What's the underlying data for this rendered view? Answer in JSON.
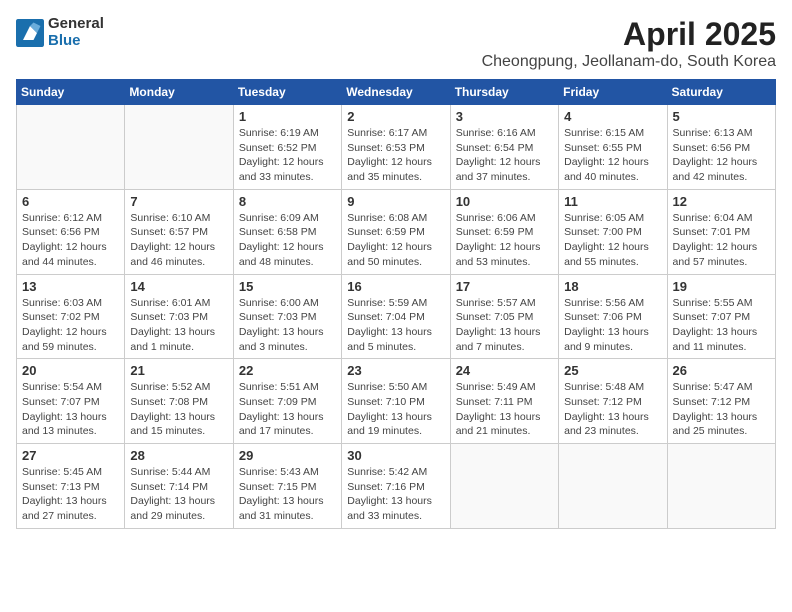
{
  "header": {
    "logo_general": "General",
    "logo_blue": "Blue",
    "month_title": "April 2025",
    "location": "Cheongpung, Jeollanam-do, South Korea"
  },
  "days_of_week": [
    "Sunday",
    "Monday",
    "Tuesday",
    "Wednesday",
    "Thursday",
    "Friday",
    "Saturday"
  ],
  "weeks": [
    [
      {
        "day": null
      },
      {
        "day": null
      },
      {
        "day": "1",
        "sunrise": "Sunrise: 6:19 AM",
        "sunset": "Sunset: 6:52 PM",
        "daylight": "Daylight: 12 hours and 33 minutes."
      },
      {
        "day": "2",
        "sunrise": "Sunrise: 6:17 AM",
        "sunset": "Sunset: 6:53 PM",
        "daylight": "Daylight: 12 hours and 35 minutes."
      },
      {
        "day": "3",
        "sunrise": "Sunrise: 6:16 AM",
        "sunset": "Sunset: 6:54 PM",
        "daylight": "Daylight: 12 hours and 37 minutes."
      },
      {
        "day": "4",
        "sunrise": "Sunrise: 6:15 AM",
        "sunset": "Sunset: 6:55 PM",
        "daylight": "Daylight: 12 hours and 40 minutes."
      },
      {
        "day": "5",
        "sunrise": "Sunrise: 6:13 AM",
        "sunset": "Sunset: 6:56 PM",
        "daylight": "Daylight: 12 hours and 42 minutes."
      }
    ],
    [
      {
        "day": "6",
        "sunrise": "Sunrise: 6:12 AM",
        "sunset": "Sunset: 6:56 PM",
        "daylight": "Daylight: 12 hours and 44 minutes."
      },
      {
        "day": "7",
        "sunrise": "Sunrise: 6:10 AM",
        "sunset": "Sunset: 6:57 PM",
        "daylight": "Daylight: 12 hours and 46 minutes."
      },
      {
        "day": "8",
        "sunrise": "Sunrise: 6:09 AM",
        "sunset": "Sunset: 6:58 PM",
        "daylight": "Daylight: 12 hours and 48 minutes."
      },
      {
        "day": "9",
        "sunrise": "Sunrise: 6:08 AM",
        "sunset": "Sunset: 6:59 PM",
        "daylight": "Daylight: 12 hours and 50 minutes."
      },
      {
        "day": "10",
        "sunrise": "Sunrise: 6:06 AM",
        "sunset": "Sunset: 6:59 PM",
        "daylight": "Daylight: 12 hours and 53 minutes."
      },
      {
        "day": "11",
        "sunrise": "Sunrise: 6:05 AM",
        "sunset": "Sunset: 7:00 PM",
        "daylight": "Daylight: 12 hours and 55 minutes."
      },
      {
        "day": "12",
        "sunrise": "Sunrise: 6:04 AM",
        "sunset": "Sunset: 7:01 PM",
        "daylight": "Daylight: 12 hours and 57 minutes."
      }
    ],
    [
      {
        "day": "13",
        "sunrise": "Sunrise: 6:03 AM",
        "sunset": "Sunset: 7:02 PM",
        "daylight": "Daylight: 12 hours and 59 minutes."
      },
      {
        "day": "14",
        "sunrise": "Sunrise: 6:01 AM",
        "sunset": "Sunset: 7:03 PM",
        "daylight": "Daylight: 13 hours and 1 minute."
      },
      {
        "day": "15",
        "sunrise": "Sunrise: 6:00 AM",
        "sunset": "Sunset: 7:03 PM",
        "daylight": "Daylight: 13 hours and 3 minutes."
      },
      {
        "day": "16",
        "sunrise": "Sunrise: 5:59 AM",
        "sunset": "Sunset: 7:04 PM",
        "daylight": "Daylight: 13 hours and 5 minutes."
      },
      {
        "day": "17",
        "sunrise": "Sunrise: 5:57 AM",
        "sunset": "Sunset: 7:05 PM",
        "daylight": "Daylight: 13 hours and 7 minutes."
      },
      {
        "day": "18",
        "sunrise": "Sunrise: 5:56 AM",
        "sunset": "Sunset: 7:06 PM",
        "daylight": "Daylight: 13 hours and 9 minutes."
      },
      {
        "day": "19",
        "sunrise": "Sunrise: 5:55 AM",
        "sunset": "Sunset: 7:07 PM",
        "daylight": "Daylight: 13 hours and 11 minutes."
      }
    ],
    [
      {
        "day": "20",
        "sunrise": "Sunrise: 5:54 AM",
        "sunset": "Sunset: 7:07 PM",
        "daylight": "Daylight: 13 hours and 13 minutes."
      },
      {
        "day": "21",
        "sunrise": "Sunrise: 5:52 AM",
        "sunset": "Sunset: 7:08 PM",
        "daylight": "Daylight: 13 hours and 15 minutes."
      },
      {
        "day": "22",
        "sunrise": "Sunrise: 5:51 AM",
        "sunset": "Sunset: 7:09 PM",
        "daylight": "Daylight: 13 hours and 17 minutes."
      },
      {
        "day": "23",
        "sunrise": "Sunrise: 5:50 AM",
        "sunset": "Sunset: 7:10 PM",
        "daylight": "Daylight: 13 hours and 19 minutes."
      },
      {
        "day": "24",
        "sunrise": "Sunrise: 5:49 AM",
        "sunset": "Sunset: 7:11 PM",
        "daylight": "Daylight: 13 hours and 21 minutes."
      },
      {
        "day": "25",
        "sunrise": "Sunrise: 5:48 AM",
        "sunset": "Sunset: 7:12 PM",
        "daylight": "Daylight: 13 hours and 23 minutes."
      },
      {
        "day": "26",
        "sunrise": "Sunrise: 5:47 AM",
        "sunset": "Sunset: 7:12 PM",
        "daylight": "Daylight: 13 hours and 25 minutes."
      }
    ],
    [
      {
        "day": "27",
        "sunrise": "Sunrise: 5:45 AM",
        "sunset": "Sunset: 7:13 PM",
        "daylight": "Daylight: 13 hours and 27 minutes."
      },
      {
        "day": "28",
        "sunrise": "Sunrise: 5:44 AM",
        "sunset": "Sunset: 7:14 PM",
        "daylight": "Daylight: 13 hours and 29 minutes."
      },
      {
        "day": "29",
        "sunrise": "Sunrise: 5:43 AM",
        "sunset": "Sunset: 7:15 PM",
        "daylight": "Daylight: 13 hours and 31 minutes."
      },
      {
        "day": "30",
        "sunrise": "Sunrise: 5:42 AM",
        "sunset": "Sunset: 7:16 PM",
        "daylight": "Daylight: 13 hours and 33 minutes."
      },
      {
        "day": null
      },
      {
        "day": null
      },
      {
        "day": null
      }
    ]
  ]
}
